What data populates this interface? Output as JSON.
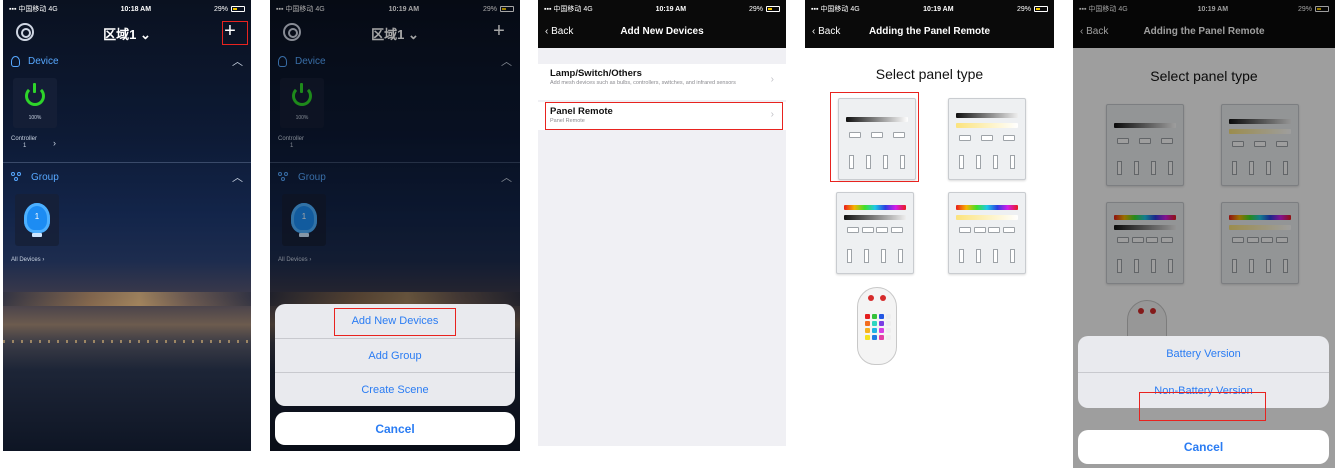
{
  "status": {
    "carrier": "中国移动",
    "network": "4G",
    "times": [
      "10:18 AM",
      "10:19 AM",
      "10:19 AM",
      "10:19 AM",
      "10:19 AM"
    ],
    "battery": "29%"
  },
  "home": {
    "region_title": "区域1",
    "device_section": "Device",
    "device_tile_percent": "100%",
    "controller_label": "Controller",
    "controller_count": "1",
    "group_section": "Group",
    "group_badge": "1",
    "all_devices_label": "All Devices"
  },
  "action_sheet": {
    "items": [
      "Add New Devices",
      "Add Group",
      "Create Scene"
    ],
    "cancel": "Cancel"
  },
  "add_devices": {
    "back": "Back",
    "title": "Add New Devices",
    "rows": [
      {
        "title": "Lamp/Switch/Others",
        "desc": "Add mesh devices such as bulbs, controllers, switches, and infrared sensors"
      },
      {
        "title": "Panel Remote",
        "desc": "Panel Remote"
      }
    ]
  },
  "panel_type": {
    "back": "Back",
    "title": "Adding the Panel Remote",
    "heading": "Select panel type"
  },
  "version_sheet": {
    "items": [
      "Battery Version",
      "Non-Battery Version"
    ],
    "cancel": "Cancel"
  },
  "colors": {
    "accent_blue": "#2a7cf3",
    "highlight_red": "#e8231f",
    "power_green": "#2ed52a"
  },
  "icons": [
    "gear-icon",
    "plus-icon",
    "power-icon",
    "bulb-icon",
    "group-icon",
    "chevron-up-icon",
    "chevron-right-icon",
    "back-chevron-icon",
    "signal-icon",
    "battery-icon"
  ]
}
